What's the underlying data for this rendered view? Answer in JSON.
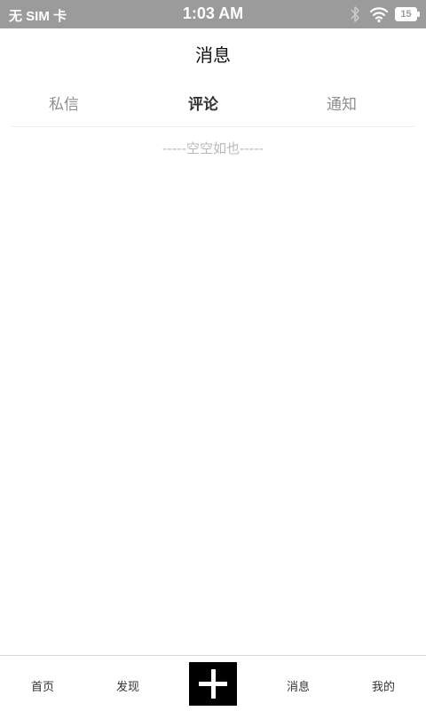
{
  "status_bar": {
    "carrier": "无 SIM 卡",
    "time": "1:03 AM",
    "battery_level": "15",
    "icons": [
      "bluetooth-icon",
      "wifi-icon",
      "battery-icon"
    ]
  },
  "header": {
    "title": "消息"
  },
  "tabs": [
    {
      "label": "私信",
      "active": false
    },
    {
      "label": "评论",
      "active": true
    },
    {
      "label": "通知",
      "active": false
    }
  ],
  "content": {
    "empty_text": "-----空空如也-----"
  },
  "bottom_nav": {
    "items": [
      {
        "label": "首页"
      },
      {
        "label": "发现"
      },
      {
        "label": "",
        "icon": "plus-icon"
      },
      {
        "label": "消息"
      },
      {
        "label": "我的"
      }
    ]
  },
  "colors": {
    "status_bar_bg": "#9b9b9b",
    "active_tab": "#333333",
    "inactive_tab": "#8e8e8e",
    "empty_text": "#b9b9b9",
    "add_button_bg": "#000000"
  }
}
